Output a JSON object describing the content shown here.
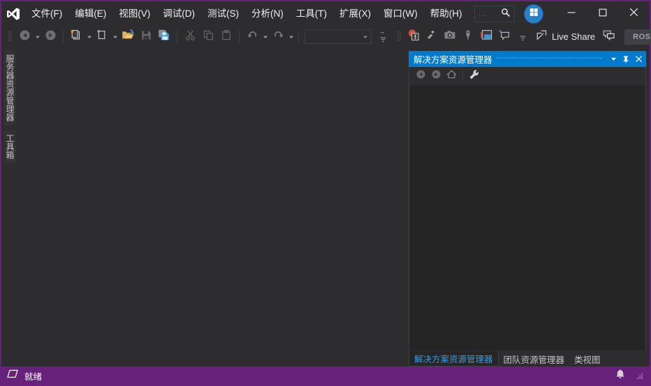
{
  "window": {
    "accent_border_color": "#68217a",
    "chrome_bg": "#2d2d30",
    "panel_bg": "#252526",
    "titlebar_active_color": "#007acc"
  },
  "menubar": {
    "logo_name": "visual-studio-logo",
    "items": [
      {
        "label": "文件(F)"
      },
      {
        "label": "编辑(E)"
      },
      {
        "label": "视图(V)"
      },
      {
        "label": "调试(D)"
      },
      {
        "label": "测试(S)"
      },
      {
        "label": "分析(N)"
      },
      {
        "label": "工具(T)"
      },
      {
        "label": "扩展(X)"
      },
      {
        "label": "窗口(W)"
      },
      {
        "label": "帮助(H)"
      }
    ],
    "quick_launch": {
      "placeholder_dots": "...",
      "icon": "search-icon"
    },
    "account": {
      "icon": "windows-account-icon"
    },
    "window_buttons": {
      "minimize": "minimize-icon",
      "maximize": "maximize-icon",
      "close": "close-icon"
    }
  },
  "toolbar": {
    "navigate_back": "navigate-back-icon",
    "navigate_forward": "navigate-forward-icon",
    "new_project": "new-project-icon",
    "new_item": "new-item-icon",
    "open_file": "open-file-icon",
    "save": "save-icon",
    "save_all": "save-all-icon",
    "cut": "cut-icon",
    "copy": "copy-icon",
    "paste": "paste-icon",
    "undo": "undo-icon",
    "redo": "redo-icon",
    "start_combo_value": "",
    "error_list": "error-list-icon",
    "performance": "performance-icon",
    "screenshot": "screenshot-icon",
    "pin": "pin-icon",
    "layout": "layout-icon",
    "feedback": "feedback-icon",
    "live_share_label": "Live Share",
    "live_share_icon": "live-share-icon",
    "comments_icon": "comments-icon",
    "rosl_label": "ROSL..."
  },
  "left_strip": {
    "tabs": [
      {
        "label": "服务器资源管理器",
        "name": "server-explorer"
      },
      {
        "label": "工具箱",
        "name": "toolbox"
      }
    ]
  },
  "solution_explorer": {
    "title": "解决方案资源管理器",
    "title_buttons": {
      "dropdown": "chevron-down-icon",
      "pin": "pin-icon",
      "close": "close-icon"
    },
    "toolbar": {
      "back": "back-icon",
      "forward": "forward-icon",
      "home": "home-icon",
      "properties": "wrench-icon"
    },
    "content_items": [],
    "tabs": [
      {
        "label": "解决方案资源管理器",
        "active": true
      },
      {
        "label": "团队资源管理器",
        "active": false
      },
      {
        "label": "类视图",
        "active": false
      }
    ]
  },
  "statusbar": {
    "icon": "ready-indicator-icon",
    "text": "就绪",
    "notification_icon": "bell-icon",
    "resize_grip": "resize-grip-icon"
  }
}
